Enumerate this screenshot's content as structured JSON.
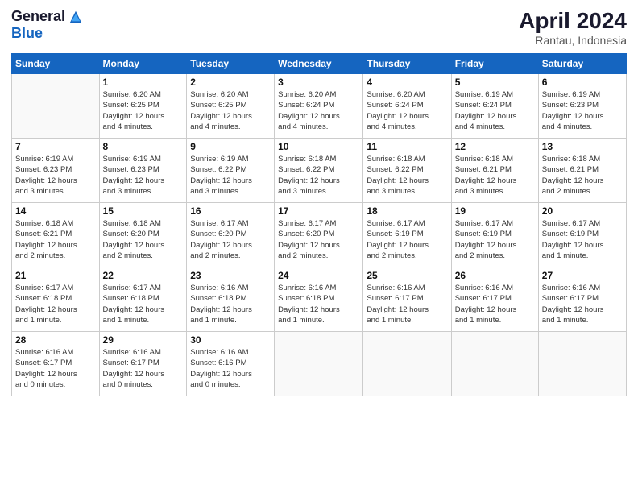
{
  "header": {
    "logo_general": "General",
    "logo_blue": "Blue",
    "month_title": "April 2024",
    "subtitle": "Rantau, Indonesia"
  },
  "weekdays": [
    "Sunday",
    "Monday",
    "Tuesday",
    "Wednesday",
    "Thursday",
    "Friday",
    "Saturday"
  ],
  "weeks": [
    [
      {
        "day": "",
        "info": ""
      },
      {
        "day": "1",
        "info": "Sunrise: 6:20 AM\nSunset: 6:25 PM\nDaylight: 12 hours\nand 4 minutes."
      },
      {
        "day": "2",
        "info": "Sunrise: 6:20 AM\nSunset: 6:25 PM\nDaylight: 12 hours\nand 4 minutes."
      },
      {
        "day": "3",
        "info": "Sunrise: 6:20 AM\nSunset: 6:24 PM\nDaylight: 12 hours\nand 4 minutes."
      },
      {
        "day": "4",
        "info": "Sunrise: 6:20 AM\nSunset: 6:24 PM\nDaylight: 12 hours\nand 4 minutes."
      },
      {
        "day": "5",
        "info": "Sunrise: 6:19 AM\nSunset: 6:24 PM\nDaylight: 12 hours\nand 4 minutes."
      },
      {
        "day": "6",
        "info": "Sunrise: 6:19 AM\nSunset: 6:23 PM\nDaylight: 12 hours\nand 4 minutes."
      }
    ],
    [
      {
        "day": "7",
        "info": "Sunrise: 6:19 AM\nSunset: 6:23 PM\nDaylight: 12 hours\nand 3 minutes."
      },
      {
        "day": "8",
        "info": "Sunrise: 6:19 AM\nSunset: 6:23 PM\nDaylight: 12 hours\nand 3 minutes."
      },
      {
        "day": "9",
        "info": "Sunrise: 6:19 AM\nSunset: 6:22 PM\nDaylight: 12 hours\nand 3 minutes."
      },
      {
        "day": "10",
        "info": "Sunrise: 6:18 AM\nSunset: 6:22 PM\nDaylight: 12 hours\nand 3 minutes."
      },
      {
        "day": "11",
        "info": "Sunrise: 6:18 AM\nSunset: 6:22 PM\nDaylight: 12 hours\nand 3 minutes."
      },
      {
        "day": "12",
        "info": "Sunrise: 6:18 AM\nSunset: 6:21 PM\nDaylight: 12 hours\nand 3 minutes."
      },
      {
        "day": "13",
        "info": "Sunrise: 6:18 AM\nSunset: 6:21 PM\nDaylight: 12 hours\nand 2 minutes."
      }
    ],
    [
      {
        "day": "14",
        "info": "Sunrise: 6:18 AM\nSunset: 6:21 PM\nDaylight: 12 hours\nand 2 minutes."
      },
      {
        "day": "15",
        "info": "Sunrise: 6:18 AM\nSunset: 6:20 PM\nDaylight: 12 hours\nand 2 minutes."
      },
      {
        "day": "16",
        "info": "Sunrise: 6:17 AM\nSunset: 6:20 PM\nDaylight: 12 hours\nand 2 minutes."
      },
      {
        "day": "17",
        "info": "Sunrise: 6:17 AM\nSunset: 6:20 PM\nDaylight: 12 hours\nand 2 minutes."
      },
      {
        "day": "18",
        "info": "Sunrise: 6:17 AM\nSunset: 6:19 PM\nDaylight: 12 hours\nand 2 minutes."
      },
      {
        "day": "19",
        "info": "Sunrise: 6:17 AM\nSunset: 6:19 PM\nDaylight: 12 hours\nand 2 minutes."
      },
      {
        "day": "20",
        "info": "Sunrise: 6:17 AM\nSunset: 6:19 PM\nDaylight: 12 hours\nand 1 minute."
      }
    ],
    [
      {
        "day": "21",
        "info": "Sunrise: 6:17 AM\nSunset: 6:18 PM\nDaylight: 12 hours\nand 1 minute."
      },
      {
        "day": "22",
        "info": "Sunrise: 6:17 AM\nSunset: 6:18 PM\nDaylight: 12 hours\nand 1 minute."
      },
      {
        "day": "23",
        "info": "Sunrise: 6:16 AM\nSunset: 6:18 PM\nDaylight: 12 hours\nand 1 minute."
      },
      {
        "day": "24",
        "info": "Sunrise: 6:16 AM\nSunset: 6:18 PM\nDaylight: 12 hours\nand 1 minute."
      },
      {
        "day": "25",
        "info": "Sunrise: 6:16 AM\nSunset: 6:17 PM\nDaylight: 12 hours\nand 1 minute."
      },
      {
        "day": "26",
        "info": "Sunrise: 6:16 AM\nSunset: 6:17 PM\nDaylight: 12 hours\nand 1 minute."
      },
      {
        "day": "27",
        "info": "Sunrise: 6:16 AM\nSunset: 6:17 PM\nDaylight: 12 hours\nand 1 minute."
      }
    ],
    [
      {
        "day": "28",
        "info": "Sunrise: 6:16 AM\nSunset: 6:17 PM\nDaylight: 12 hours\nand 0 minutes."
      },
      {
        "day": "29",
        "info": "Sunrise: 6:16 AM\nSunset: 6:17 PM\nDaylight: 12 hours\nand 0 minutes."
      },
      {
        "day": "30",
        "info": "Sunrise: 6:16 AM\nSunset: 6:16 PM\nDaylight: 12 hours\nand 0 minutes."
      },
      {
        "day": "",
        "info": ""
      },
      {
        "day": "",
        "info": ""
      },
      {
        "day": "",
        "info": ""
      },
      {
        "day": "",
        "info": ""
      }
    ]
  ]
}
